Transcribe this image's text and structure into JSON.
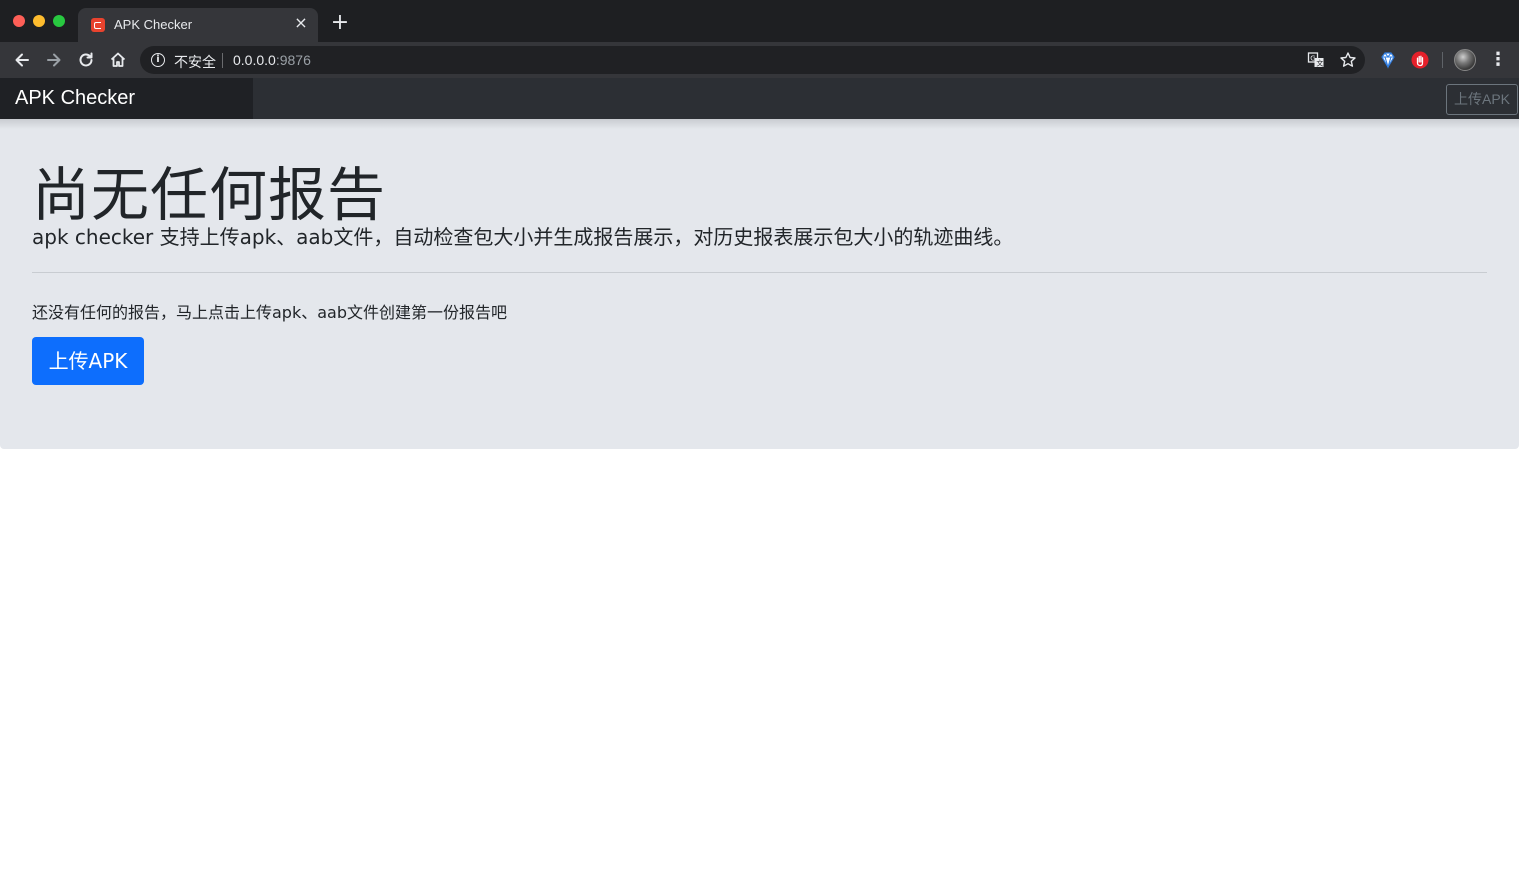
{
  "browser": {
    "tab_title": "APK Checker",
    "tab_close": "×",
    "new_tab": "+",
    "security_label": "不安全",
    "url_host": "0.0.0.0",
    "url_port": ":9876",
    "icons": {
      "favicon": "apk-checker-favicon",
      "back": "back-arrow-icon",
      "forward": "forward-arrow-icon",
      "reload": "reload-icon",
      "home": "home-icon",
      "info": "info-icon",
      "translate": "translate-icon",
      "bookmark": "star-icon",
      "extension1": "diamond-extension-icon",
      "extension2": "hand-stop-extension-icon",
      "profile": "profile-avatar",
      "menu": "more-vertical-icon"
    },
    "colors": {
      "tabbar": "#1e1f22",
      "toolbar": "#35363a",
      "omnibox": "#202124"
    }
  },
  "app": {
    "brand": "APK Checker",
    "nav_upload_label": "上传APK",
    "headline": "尚无任何报告",
    "lead": "apk checker 支持上传apk、aab文件，自动检查包大小并生成报告展示，对历史报表展示包大小的轨迹曲线。",
    "empty_message": "还没有任何的报告，马上点击上传apk、aab文件创建第一份报告吧",
    "cta_label": "上传APK",
    "colors": {
      "primary": "#0d6efd",
      "navbar": "#2c2f34",
      "jumbotron": "#e4e7ec"
    }
  }
}
